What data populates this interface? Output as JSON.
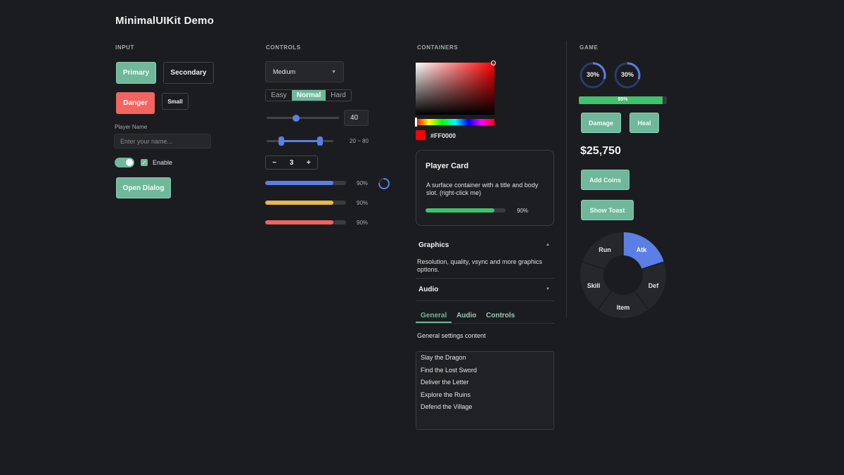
{
  "title": "MinimalUIKit Demo",
  "sections": {
    "input": "INPUT",
    "controls": "CONTROLS",
    "containers": "CONTAINERS",
    "game": "GAME"
  },
  "input": {
    "primary": "Primary",
    "secondary": "Secondary",
    "danger": "Danger",
    "small": "Small",
    "player_name_label": "Player Name",
    "player_name_placeholder": "Enter your name...",
    "toggle_on": true,
    "checkbox_label": "Enable",
    "checkbox_checked": true,
    "open_dialog": "Open Dialog"
  },
  "controls": {
    "dropdown_value": "Medium",
    "difficulty": [
      "Easy",
      "Normal",
      "Hard"
    ],
    "difficulty_selected": "Normal",
    "slider_value": "40",
    "range_text": "20 ~ 80",
    "range_low": 20,
    "range_high": 80,
    "stepper_value": "3",
    "stepper_minus": "−",
    "stepper_plus": "+",
    "progress": [
      {
        "label": "90%",
        "color": "#5b7fe5",
        "value": 0.9
      },
      {
        "label": "90%",
        "color": "#e8b64f",
        "value": 0.9
      },
      {
        "label": "90%",
        "color": "#f2645f",
        "value": 0.9
      }
    ]
  },
  "containers": {
    "color_hex": "#FF0000",
    "swatch_color": "#ff0000",
    "card_title": "Player Card",
    "card_body": "A surface container with a title and body slot. (right-click me)",
    "card_progress_label": "90%",
    "card_progress": 0.9,
    "accordion_graphics_title": "Graphics",
    "accordion_graphics_body": "Resolution, quality, vsync and more graphics options.",
    "accordion_audio_title": "Audio",
    "accordion_up": "▲",
    "accordion_down": "▼",
    "tabs": [
      "General",
      "Audio",
      "Controls"
    ],
    "tab_content": "General settings content",
    "quests": [
      "Slay the Dragon",
      "Find the Lost Sword",
      "Deliver the Letter",
      "Explore the Ruins",
      "Defend the Village"
    ]
  },
  "game": {
    "ring1_label": "30%",
    "ring2_label": "30%",
    "ring_value": 0.3,
    "bar_label": "95%",
    "bar_value": 0.95,
    "damage": "Damage",
    "heal": "Heal",
    "money": "$25,750",
    "add_coins": "Add Coins",
    "show_toast": "Show Toast",
    "radial": [
      "Atk",
      "Def",
      "Item",
      "Skill",
      "Run"
    ],
    "radial_selected": "Atk"
  },
  "colors": {
    "accent": "#6fb89b",
    "danger": "#f2645f",
    "blue": "#5b7fe5",
    "yellow": "#e8b64f",
    "green": "#3fc26b",
    "background": "#1b1c1f"
  }
}
